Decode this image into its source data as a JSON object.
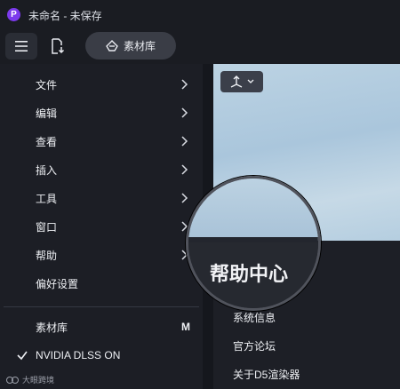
{
  "window": {
    "title": "未命名 - 未保存",
    "logo_letter": "P"
  },
  "toolbar": {
    "library_label": "素材库"
  },
  "main_menu": {
    "items": [
      {
        "label": "文件"
      },
      {
        "label": "编辑"
      },
      {
        "label": "查看"
      },
      {
        "label": "插入"
      },
      {
        "label": "工具"
      },
      {
        "label": "窗口"
      },
      {
        "label": "帮助"
      },
      {
        "label": "偏好设置"
      }
    ],
    "library": {
      "label": "素材库",
      "shortcut": "M"
    },
    "dlss": {
      "label": "NVIDIA DLSS ON",
      "checked": true
    }
  },
  "help_submenu": {
    "highlighted": "帮助中心",
    "items": [
      "系统信息",
      "官方论坛",
      "关于D5渲染器"
    ]
  },
  "watermark": {
    "text": "大眼跨境"
  },
  "colors": {
    "accent": "#7c3aed",
    "menu_bg": "#1c1e25",
    "viewport_sky": "#b5cee0"
  }
}
